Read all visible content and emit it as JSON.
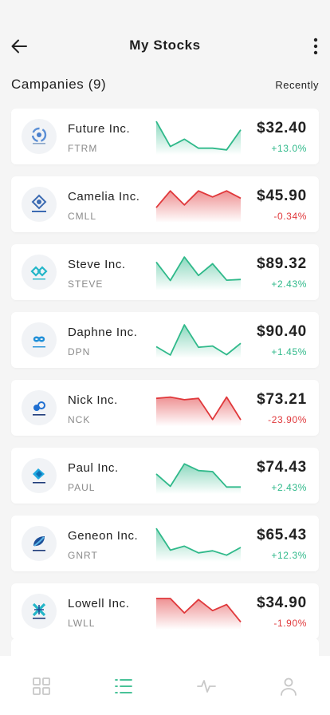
{
  "header": {
    "title": "My Stocks"
  },
  "section": {
    "title": "Campanies (9)",
    "sort_label": "Recently"
  },
  "colors": {
    "up": "#2fb98a",
    "down": "#e0383b",
    "tab_active": "#2fb98a",
    "tab_inactive": "#c8c8c8"
  },
  "stocks": [
    {
      "name": "Future Inc.",
      "ticker": "FTRM",
      "price": "$32.40",
      "change": "+13.0%",
      "trend": "up",
      "logo_icon": "company-badge-swirl-icon",
      "spark": [
        0.95,
        0.2,
        0.42,
        0.15,
        0.15,
        0.1,
        0.7
      ]
    },
    {
      "name": "Camelia Inc.",
      "ticker": "CMLL",
      "price": "$45.90",
      "change": "-0.34%",
      "trend": "down",
      "logo_icon": "company-badge-geo-icon",
      "spark": [
        0.4,
        0.9,
        0.48,
        0.9,
        0.72,
        0.9,
        0.68
      ]
    },
    {
      "name": "Steve Inc.",
      "ticker": "STEVE",
      "price": "$89.32",
      "change": "+2.43%",
      "trend": "up",
      "logo_icon": "company-badge-chain-icon",
      "spark": [
        0.8,
        0.25,
        0.95,
        0.4,
        0.75,
        0.26,
        0.28
      ]
    },
    {
      "name": "Daphne Inc.",
      "ticker": "DPN",
      "price": "$90.40",
      "change": "+1.45%",
      "trend": "up",
      "logo_icon": "company-badge-loop-icon",
      "spark": [
        0.3,
        0.05,
        0.95,
        0.28,
        0.32,
        0.06,
        0.4
      ]
    },
    {
      "name": "Nick Inc.",
      "ticker": "NCK",
      "price": "$73.21",
      "change": "-23.90%",
      "trend": "down",
      "logo_icon": "company-badge-knot-icon",
      "spark": [
        0.78,
        0.82,
        0.74,
        0.78,
        0.15,
        0.82,
        0.14
      ]
    },
    {
      "name": "Paul Inc.",
      "ticker": "PAUL",
      "price": "$74.43",
      "change": "+2.43%",
      "trend": "up",
      "logo_icon": "company-badge-arrow-icon",
      "spark": [
        0.55,
        0.18,
        0.85,
        0.65,
        0.62,
        0.16,
        0.16
      ]
    },
    {
      "name": "Geneon Inc.",
      "ticker": "GNRT",
      "price": "$65.43",
      "change": "+12.3%",
      "trend": "up",
      "logo_icon": "company-badge-leaf-icon",
      "spark": [
        0.95,
        0.3,
        0.42,
        0.22,
        0.28,
        0.15,
        0.38
      ]
    },
    {
      "name": "Lowell Inc.",
      "ticker": "LWLL",
      "price": "$34.90",
      "change": "-1.90%",
      "trend": "down",
      "logo_icon": "company-badge-cross-icon",
      "spark": [
        0.88,
        0.88,
        0.45,
        0.85,
        0.52,
        0.7,
        0.18
      ]
    }
  ],
  "tabs": [
    {
      "id": "home",
      "icon": "grid-icon",
      "active": false
    },
    {
      "id": "list",
      "icon": "list-icon",
      "active": true
    },
    {
      "id": "activity",
      "icon": "pulse-icon",
      "active": false
    },
    {
      "id": "profile",
      "icon": "user-icon",
      "active": false
    }
  ]
}
